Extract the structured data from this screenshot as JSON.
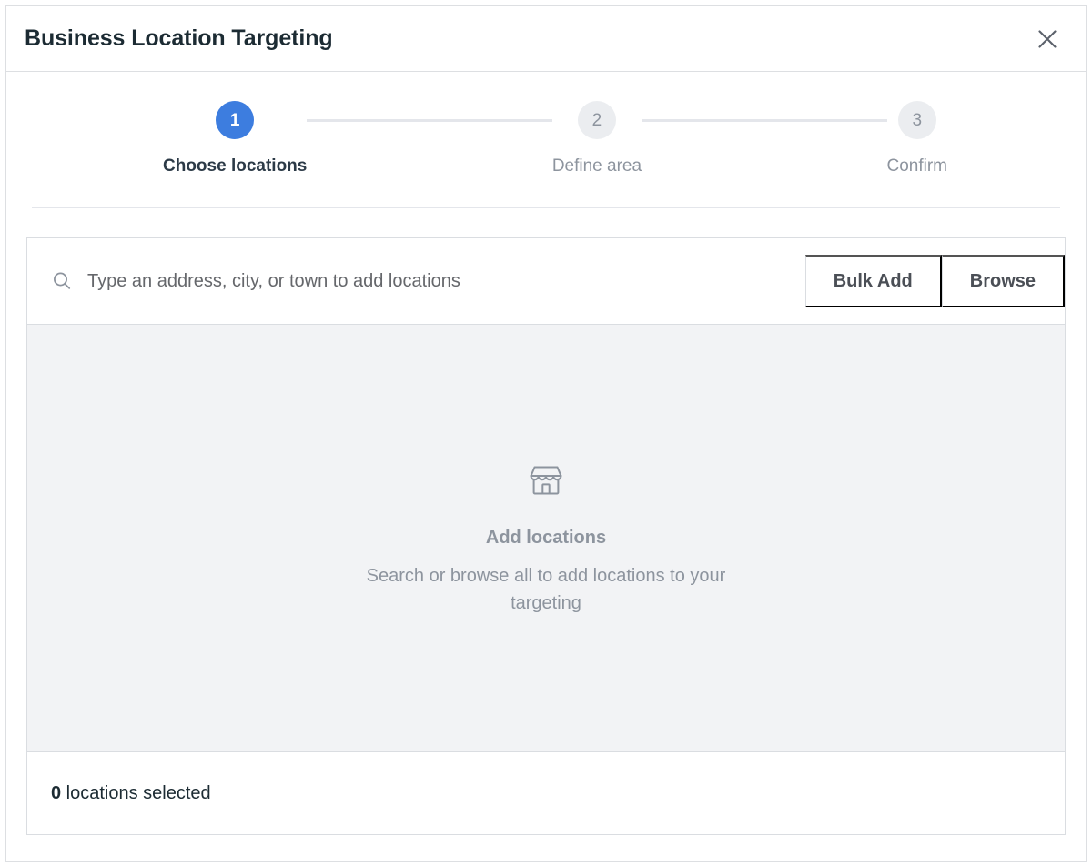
{
  "dialog": {
    "title": "Business Location Targeting",
    "close_icon": "close-icon"
  },
  "stepper": {
    "steps": [
      {
        "number": "1",
        "label": "Choose locations",
        "state": "active"
      },
      {
        "number": "2",
        "label": "Define area",
        "state": "upcoming"
      },
      {
        "number": "3",
        "label": "Confirm",
        "state": "upcoming"
      }
    ]
  },
  "search": {
    "icon": "search-icon",
    "placeholder": "Type an address, city, or town to add locations",
    "value": "",
    "bulk_add_label": "Bulk Add",
    "browse_label": "Browse"
  },
  "empty_state": {
    "icon": "storefront-icon",
    "title": "Add locations",
    "subtitle": "Search or browse all to add locations to your targeting"
  },
  "footer": {
    "count": "0",
    "count_suffix": " locations selected"
  },
  "colors": {
    "accent": "#3d7ddf",
    "step_inactive_bg": "#ebedf0",
    "muted_text": "#8d949e",
    "empty_bg": "#f2f3f5",
    "border": "#dadde1",
    "title_text": "#1c2b33"
  }
}
